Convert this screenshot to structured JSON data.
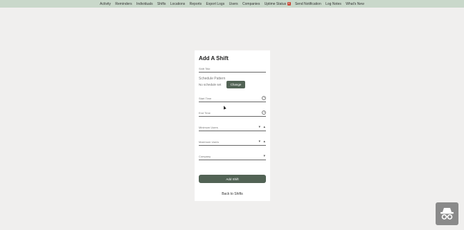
{
  "nav": {
    "items": [
      "Activity",
      "Reminders",
      "Individuals",
      "Shifts",
      "Locations",
      "Reports",
      "Export Logs",
      "Users",
      "Companies",
      "Uptime Status",
      "Send Notification",
      "Log Notes",
      "What's New"
    ],
    "uptime_badge": "4"
  },
  "form": {
    "title": "Add A Shift",
    "shift_title_placeholder": "Shift Title",
    "schedule_label": "Schedule Pattern",
    "schedule_value": "No schedule set",
    "change_label": "Change",
    "start_time_placeholder": "Start Time",
    "end_time_placeholder": "End Time",
    "min_users_placeholder": "Minimum Users",
    "max_users_placeholder": "Maximum Users",
    "company_placeholder": "Company",
    "submit_label": "Add Shift",
    "back_label": "Back to Shifts"
  },
  "colors": {
    "nav_bg": "#c9d8ca",
    "primary": "#526355",
    "background": "#f0efee"
  },
  "icons": [
    "clock-icon",
    "spinner-down-icon",
    "spinner-up-icon",
    "chevron-down-icon",
    "incognito-icon"
  ]
}
